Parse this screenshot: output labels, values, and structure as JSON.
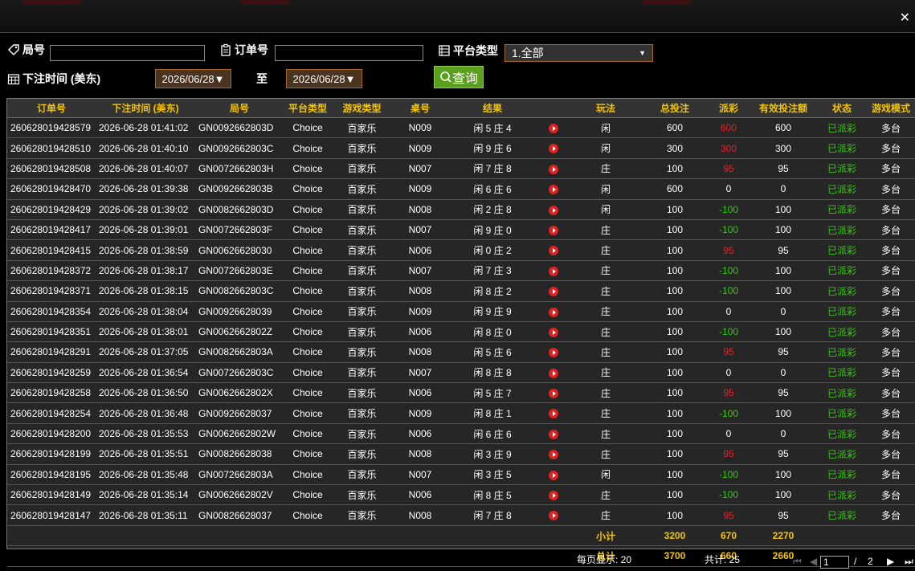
{
  "filters": {
    "round_label": "局号",
    "round_value": "",
    "order_label": "订单号",
    "order_value": "",
    "platform_label": "平台类型",
    "platform_selected": "1.全部",
    "time_label": "下注时间 (美东)",
    "date_from": "2026/06/28",
    "to_label": "至",
    "date_to": "2026/06/28",
    "query_label": "查询"
  },
  "table": {
    "headers": [
      "订单号",
      "下注时间 (美东)",
      "局号",
      "平台类型",
      "游戏类型",
      "桌号",
      "结果",
      "",
      "玩法",
      "总投注",
      "派彩",
      "有效投注额",
      "状态",
      "游戏模式"
    ],
    "rows": [
      {
        "order": "260628019428579",
        "time": "2026-06-28 01:41:02",
        "round": "GN0092662803D",
        "platform": "Choice",
        "game": "百家乐",
        "table": "N009",
        "result": "闲 5 庄 4",
        "play": "闲",
        "bet": "600",
        "payout": "600",
        "valid": "600",
        "status": "已派彩",
        "mode": "多台"
      },
      {
        "order": "260628019428510",
        "time": "2026-06-28 01:40:10",
        "round": "GN0092662803C",
        "platform": "Choice",
        "game": "百家乐",
        "table": "N009",
        "result": "闲 9 庄 6",
        "play": "闲",
        "bet": "300",
        "payout": "300",
        "valid": "300",
        "status": "已派彩",
        "mode": "多台"
      },
      {
        "order": "260628019428508",
        "time": "2026-06-28 01:40:07",
        "round": "GN0072662803H",
        "platform": "Choice",
        "game": "百家乐",
        "table": "N007",
        "result": "闲 7 庄 8",
        "play": "庄",
        "bet": "100",
        "payout": "95",
        "valid": "95",
        "status": "已派彩",
        "mode": "多台"
      },
      {
        "order": "260628019428470",
        "time": "2026-06-28 01:39:38",
        "round": "GN0092662803B",
        "platform": "Choice",
        "game": "百家乐",
        "table": "N009",
        "result": "闲 6 庄 6",
        "play": "闲",
        "bet": "600",
        "payout": "0",
        "valid": "0",
        "status": "已派彩",
        "mode": "多台"
      },
      {
        "order": "260628019428429",
        "time": "2026-06-28 01:39:02",
        "round": "GN0082662803D",
        "platform": "Choice",
        "game": "百家乐",
        "table": "N008",
        "result": "闲 2 庄 8",
        "play": "闲",
        "bet": "100",
        "payout": "-100",
        "valid": "100",
        "status": "已派彩",
        "mode": "多台"
      },
      {
        "order": "260628019428417",
        "time": "2026-06-28 01:39:01",
        "round": "GN0072662803F",
        "platform": "Choice",
        "game": "百家乐",
        "table": "N007",
        "result": "闲 9 庄 0",
        "play": "庄",
        "bet": "100",
        "payout": "-100",
        "valid": "100",
        "status": "已派彩",
        "mode": "多台"
      },
      {
        "order": "260628019428415",
        "time": "2026-06-28 01:38:59",
        "round": "GN00626628030",
        "platform": "Choice",
        "game": "百家乐",
        "table": "N006",
        "result": "闲 0 庄 2",
        "play": "庄",
        "bet": "100",
        "payout": "95",
        "valid": "95",
        "status": "已派彩",
        "mode": "多台"
      },
      {
        "order": "260628019428372",
        "time": "2026-06-28 01:38:17",
        "round": "GN0072662803E",
        "platform": "Choice",
        "game": "百家乐",
        "table": "N007",
        "result": "闲 7 庄 3",
        "play": "庄",
        "bet": "100",
        "payout": "-100",
        "valid": "100",
        "status": "已派彩",
        "mode": "多台"
      },
      {
        "order": "260628019428371",
        "time": "2026-06-28 01:38:15",
        "round": "GN0082662803C",
        "platform": "Choice",
        "game": "百家乐",
        "table": "N008",
        "result": "闲 8 庄 2",
        "play": "庄",
        "bet": "100",
        "payout": "-100",
        "valid": "100",
        "status": "已派彩",
        "mode": "多台"
      },
      {
        "order": "260628019428354",
        "time": "2026-06-28 01:38:04",
        "round": "GN00926628039",
        "platform": "Choice",
        "game": "百家乐",
        "table": "N009",
        "result": "闲 9 庄 9",
        "play": "庄",
        "bet": "100",
        "payout": "0",
        "valid": "0",
        "status": "已派彩",
        "mode": "多台"
      },
      {
        "order": "260628019428351",
        "time": "2026-06-28 01:38:01",
        "round": "GN0062662802Z",
        "platform": "Choice",
        "game": "百家乐",
        "table": "N006",
        "result": "闲 8 庄 0",
        "play": "庄",
        "bet": "100",
        "payout": "-100",
        "valid": "100",
        "status": "已派彩",
        "mode": "多台"
      },
      {
        "order": "260628019428291",
        "time": "2026-06-28 01:37:05",
        "round": "GN0082662803A",
        "platform": "Choice",
        "game": "百家乐",
        "table": "N008",
        "result": "闲 5 庄 6",
        "play": "庄",
        "bet": "100",
        "payout": "95",
        "valid": "95",
        "status": "已派彩",
        "mode": "多台"
      },
      {
        "order": "260628019428259",
        "time": "2026-06-28 01:36:54",
        "round": "GN0072662803C",
        "platform": "Choice",
        "game": "百家乐",
        "table": "N007",
        "result": "闲 8 庄 8",
        "play": "庄",
        "bet": "100",
        "payout": "0",
        "valid": "0",
        "status": "已派彩",
        "mode": "多台"
      },
      {
        "order": "260628019428258",
        "time": "2026-06-28 01:36:50",
        "round": "GN0062662802X",
        "platform": "Choice",
        "game": "百家乐",
        "table": "N006",
        "result": "闲 5 庄 7",
        "play": "庄",
        "bet": "100",
        "payout": "95",
        "valid": "95",
        "status": "已派彩",
        "mode": "多台"
      },
      {
        "order": "260628019428254",
        "time": "2026-06-28 01:36:48",
        "round": "GN00926628037",
        "platform": "Choice",
        "game": "百家乐",
        "table": "N009",
        "result": "闲 8 庄 1",
        "play": "庄",
        "bet": "100",
        "payout": "-100",
        "valid": "100",
        "status": "已派彩",
        "mode": "多台"
      },
      {
        "order": "260628019428200",
        "time": "2026-06-28 01:35:53",
        "round": "GN0062662802W",
        "platform": "Choice",
        "game": "百家乐",
        "table": "N006",
        "result": "闲 6 庄 6",
        "play": "庄",
        "bet": "100",
        "payout": "0",
        "valid": "0",
        "status": "已派彩",
        "mode": "多台"
      },
      {
        "order": "260628019428199",
        "time": "2026-06-28 01:35:51",
        "round": "GN00826628038",
        "platform": "Choice",
        "game": "百家乐",
        "table": "N008",
        "result": "闲 3 庄 9",
        "play": "庄",
        "bet": "100",
        "payout": "95",
        "valid": "95",
        "status": "已派彩",
        "mode": "多台"
      },
      {
        "order": "260628019428195",
        "time": "2026-06-28 01:35:48",
        "round": "GN0072662803A",
        "platform": "Choice",
        "game": "百家乐",
        "table": "N007",
        "result": "闲 3 庄 5",
        "play": "闲",
        "bet": "100",
        "payout": "-100",
        "valid": "100",
        "status": "已派彩",
        "mode": "多台"
      },
      {
        "order": "260628019428149",
        "time": "2026-06-28 01:35:14",
        "round": "GN0062662802V",
        "platform": "Choice",
        "game": "百家乐",
        "table": "N006",
        "result": "闲 8 庄 5",
        "play": "庄",
        "bet": "100",
        "payout": "-100",
        "valid": "100",
        "status": "已派彩",
        "mode": "多台"
      },
      {
        "order": "260628019428147",
        "time": "2026-06-28 01:35:11",
        "round": "GN00826628037",
        "platform": "Choice",
        "game": "百家乐",
        "table": "N008",
        "result": "闲 7 庄 8",
        "play": "庄",
        "bet": "100",
        "payout": "95",
        "valid": "95",
        "status": "已派彩",
        "mode": "多台"
      }
    ],
    "subtotal": {
      "label": "小计",
      "bet": "3200",
      "payout": "670",
      "valid": "2270"
    },
    "total": {
      "label": "总计",
      "bet": "3700",
      "payout": "660",
      "valid": "2660"
    }
  },
  "footer": {
    "per_page": "每页显示: 20",
    "total": "共计: 25",
    "current_page": "1",
    "page_sep": "/",
    "total_pages": "2"
  },
  "colors": {
    "accent": "#f5c400",
    "positive": "#e8202a",
    "negative": "#3ec41a",
    "button": "#5aa01e"
  }
}
